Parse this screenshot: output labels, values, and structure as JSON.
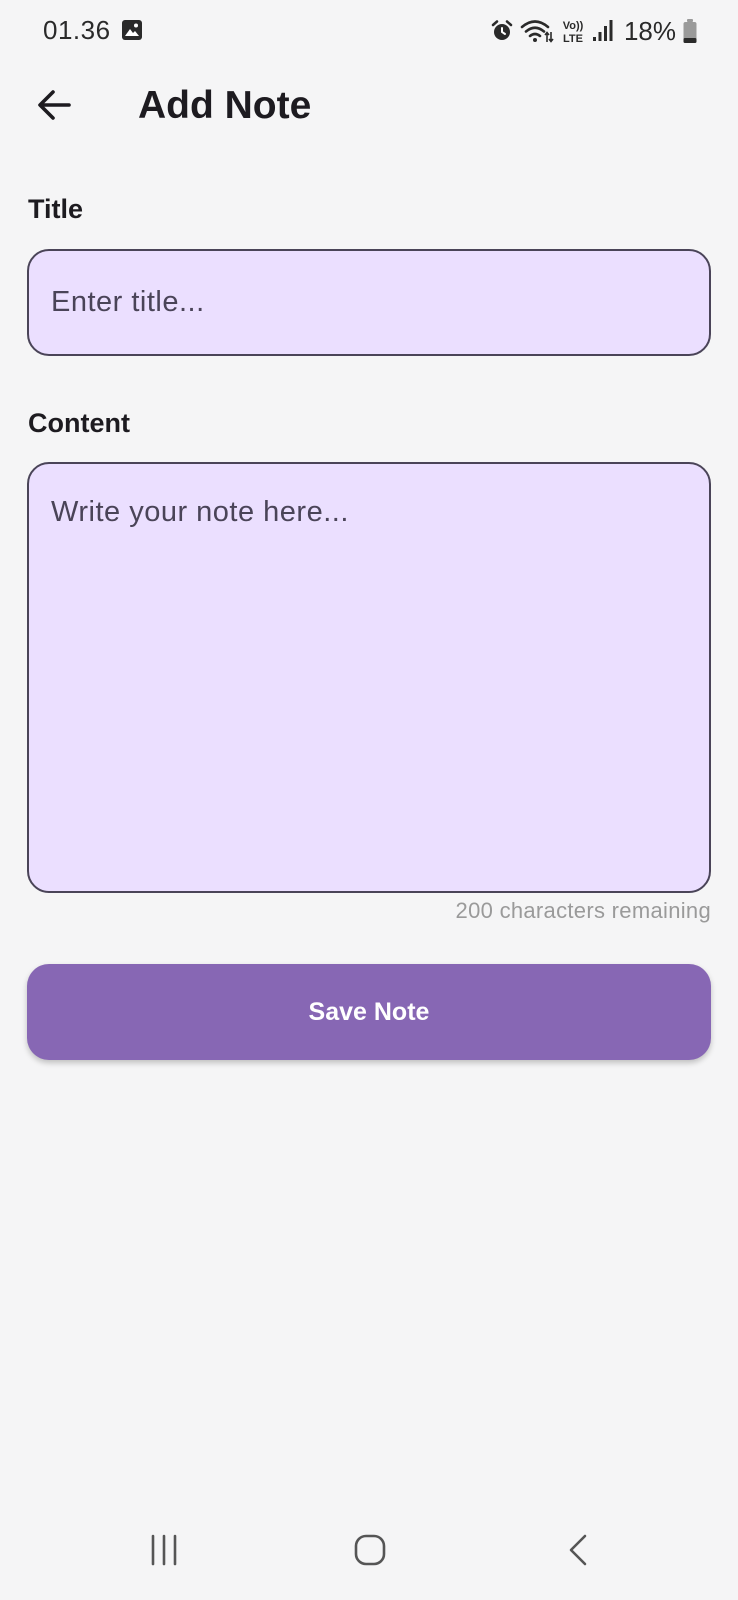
{
  "status_bar": {
    "time": "01.36",
    "battery": "18%",
    "icons": [
      "gallery-icon",
      "alarm-icon",
      "wifi-icon",
      "volte-icon",
      "signal-icon",
      "battery-icon"
    ]
  },
  "app_bar": {
    "title": "Add Note",
    "back_icon": "arrow-left-icon"
  },
  "form": {
    "title_label": "Title",
    "title_placeholder": "Enter title...",
    "title_value": "",
    "content_label": "Content",
    "content_placeholder": "Write your note here...",
    "content_value": "",
    "char_counter": "200 characters remaining",
    "save_label": "Save Note"
  },
  "nav_bar": {
    "icons": [
      "recents-icon",
      "home-icon",
      "back-icon"
    ]
  },
  "colors": {
    "background": "#f5f5f6",
    "input_fill": "#ebdfff",
    "input_border": "#4a4458",
    "primary_button": "#8767b4",
    "button_text": "#ffffff",
    "counter_text": "#9a9a9a"
  }
}
